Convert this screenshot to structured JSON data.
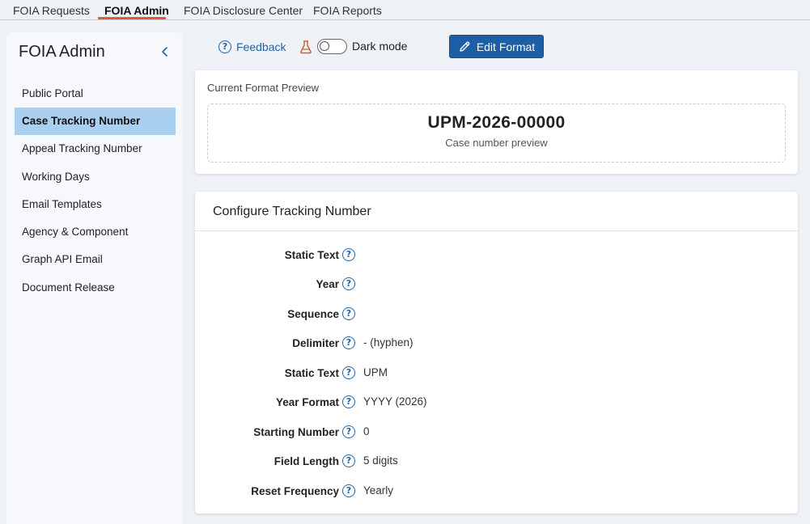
{
  "topnav": {
    "tabs": [
      {
        "label": "FOIA Requests"
      },
      {
        "label": "FOIA Admin"
      },
      {
        "label": "FOIA Disclosure Center"
      },
      {
        "label": "FOIA Reports"
      }
    ],
    "active_index": 1,
    "accent": "#e0573a"
  },
  "sidebar": {
    "title": "FOIA Admin",
    "collapse_icon": "chevron-left-icon",
    "items": [
      {
        "label": "Public Portal"
      },
      {
        "label": "Case Tracking Number"
      },
      {
        "label": "Appeal Tracking Number"
      },
      {
        "label": "Working Days"
      },
      {
        "label": "Email Templates"
      },
      {
        "label": "Agency & Component"
      },
      {
        "label": "Graph API Email"
      },
      {
        "label": "Document Release"
      }
    ],
    "active_index": 1,
    "active_color": "#a9d0f0"
  },
  "toolbar": {
    "feedback_label": "Feedback",
    "feedback_icon": "question-circle-icon",
    "lab_icon": "flask-icon",
    "dark_mode_label": "Dark mode",
    "dark_mode_on": false,
    "edit_label": "Edit Format",
    "edit_icon": "pencil-icon",
    "edit_color": "#1d5fa5"
  },
  "preview": {
    "heading": "Current Format Preview",
    "value": "UPM-2026-00000",
    "caption": "Case number preview"
  },
  "config": {
    "heading": "Configure Tracking Number",
    "help_icon": "question-circle-icon",
    "rows": [
      {
        "label": "Static Text",
        "value": ""
      },
      {
        "label": "Year",
        "value": ""
      },
      {
        "label": "Sequence",
        "value": ""
      },
      {
        "label": "Delimiter",
        "value": "- (hyphen)"
      },
      {
        "label": "Static Text",
        "value": "UPM"
      },
      {
        "label": "Year Format",
        "value": "YYYY (2026)"
      },
      {
        "label": "Starting Number",
        "value": "0"
      },
      {
        "label": "Field Length",
        "value": "5 digits"
      },
      {
        "label": "Reset Frequency",
        "value": "Yearly"
      }
    ]
  }
}
